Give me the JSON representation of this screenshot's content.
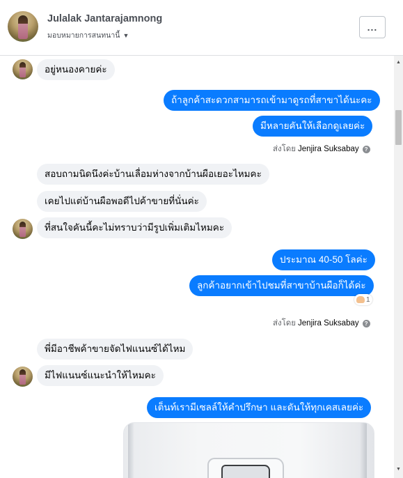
{
  "header": {
    "name": "Julalak Jantarajamnong",
    "assign_label": "มอบหมายการสนทนานี้",
    "menu_label": "..."
  },
  "messages": [
    {
      "side": "in",
      "text": "อยู่หนองคายค่ะ"
    },
    {
      "side": "out",
      "text": "ถ้าลูกค้าสะดวกสามารถเข้ามาดูรถที่สาขาได้นะคะ"
    },
    {
      "side": "out",
      "text": "มีหลายคันให้เลือกดูเลยค่ะ"
    },
    {
      "side": "in",
      "text": "สอบถามนิดนึงค่ะบ้านเลื่อมห่างจากบ้านผือเยอะไหมคะ"
    },
    {
      "side": "in",
      "text": "เคยไปแต่บ้านผือพอดีไปค้าขายที่นั่นค่ะ"
    },
    {
      "side": "in",
      "text": "ที่สนใจคันนี้คะไม่ทราบว่ามีรูปเพิ่มเติมไหมคะ"
    },
    {
      "side": "out",
      "text": "ประมาณ 40-50 โลค่ะ"
    },
    {
      "side": "out",
      "text": "ลูกค้าอยากเข้าไปชมที่สาขาบ้านผือก็ได้ค่ะ"
    },
    {
      "side": "in",
      "text": "พี่มีอาชีพค้าขายจัดไฟแนนซ์ได้ไหม"
    },
    {
      "side": "in",
      "text": "มีไฟแนนซ์แนะนำให้ไหมคะ"
    },
    {
      "side": "out",
      "text": "เต็นท์เรามีเซลล์ให้คำปรึกษา และดันให้ทุกเคสเลยค่ะ"
    }
  ],
  "sent_by": [
    {
      "prefix": "ส่งโดย",
      "name": "Jenjira Suksabay"
    },
    {
      "prefix": "ส่งโดย",
      "name": "Jenjira Suksabay"
    }
  ],
  "reaction": {
    "count": "1"
  }
}
